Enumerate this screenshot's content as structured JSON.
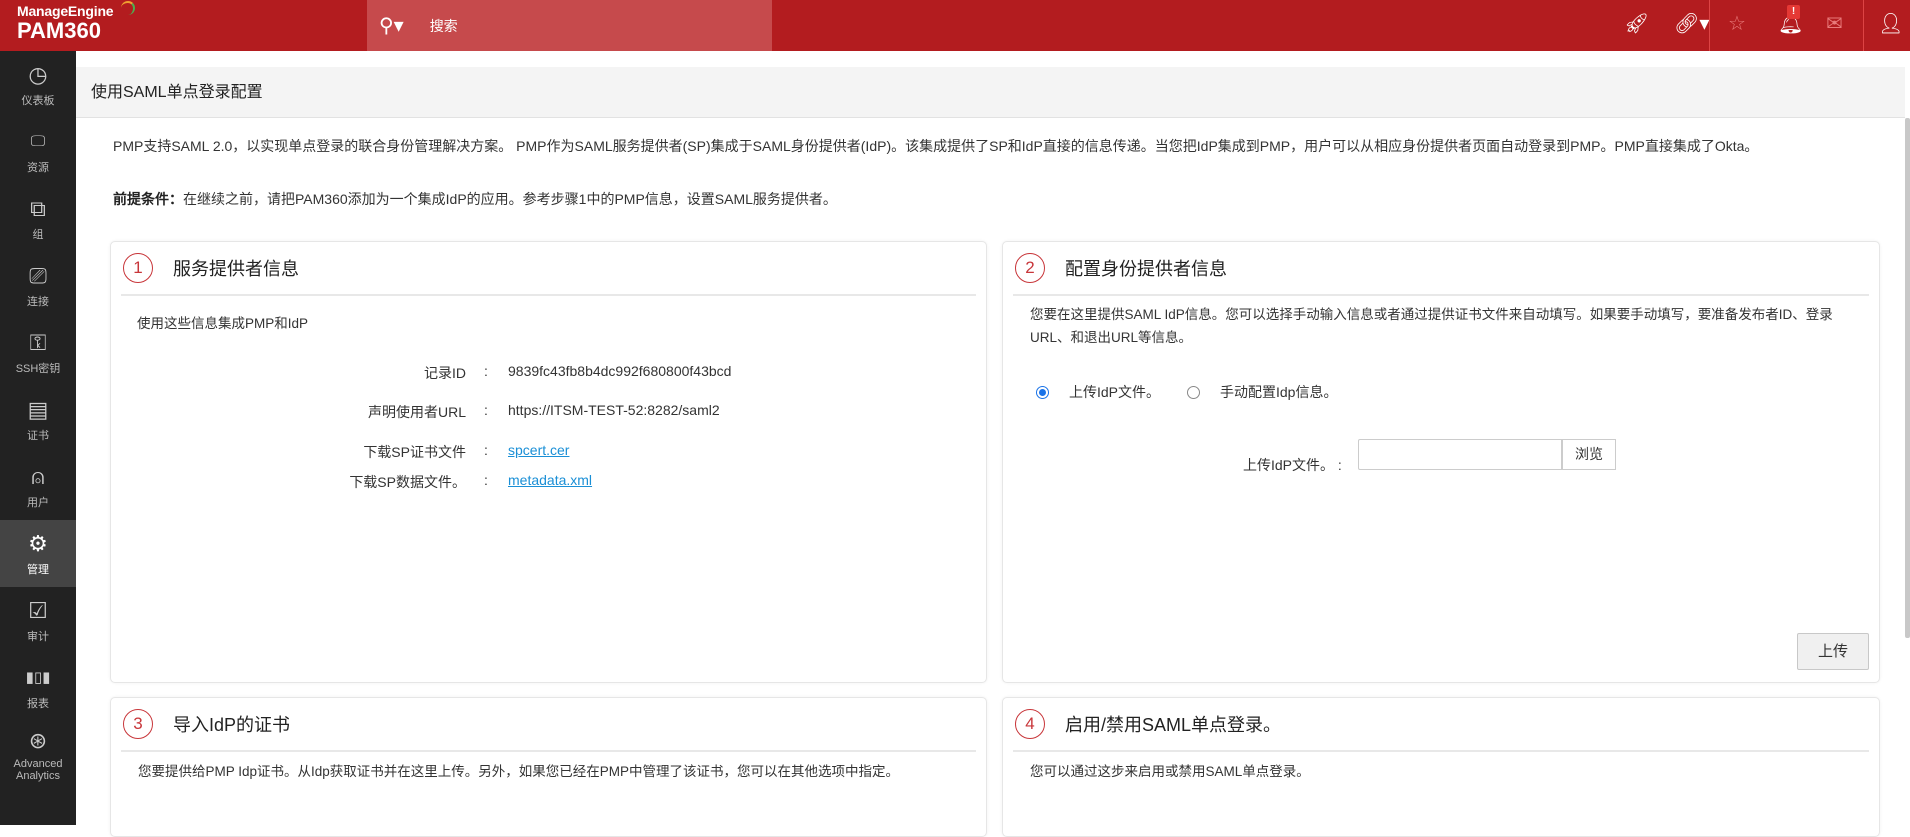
{
  "header": {
    "brand": "ManageEngine",
    "product": "PAM360",
    "search_label": "搜索",
    "notification_badge": "!"
  },
  "sidebar": {
    "items": [
      {
        "label": "仪表板",
        "icon": "dashboard-icon",
        "glyph": "◷"
      },
      {
        "label": "资源",
        "icon": "monitor-icon",
        "glyph": "🖵"
      },
      {
        "label": "组",
        "icon": "group-icon",
        "glyph": "⧉"
      },
      {
        "label": "连接",
        "icon": "connection-icon",
        "glyph": "⎚"
      },
      {
        "label": "SSH密钥",
        "icon": "ssh-key-icon",
        "glyph": "⚿"
      },
      {
        "label": "证书",
        "icon": "certificate-icon",
        "glyph": "▤"
      },
      {
        "label": "用户",
        "icon": "user-icon",
        "glyph": "⍝"
      },
      {
        "label": "管理",
        "icon": "gear-icon",
        "glyph": "⚙",
        "active": true
      },
      {
        "label": "审计",
        "icon": "clipboard-check-icon",
        "glyph": "☑"
      },
      {
        "label": "报表",
        "icon": "bar-chart-icon",
        "glyph": "▮▯▮"
      },
      {
        "label": "Advanced Analytics",
        "icon": "analytics-icon",
        "glyph": "⊛"
      }
    ]
  },
  "page": {
    "title": "使用SAML单点登录配置",
    "intro": "PMP支持SAML 2.0，以实现单点登录的联合身份管理解决方案。 PMP作为SAML服务提供者(SP)集成于SAML身份提供者(IdP)。该集成提供了SP和IdP直接的信息传递。当您把IdP集成到PMP，用户可以从相应身份提供者页面自动登录到PMP。PMP直接集成了Okta。",
    "prereq_label": "前提条件：",
    "prereq_text": "在继续之前，请把PAM360添加为一个集成IdP的应用。参考步骤1中的PMP信息，设置SAML服务提供者。"
  },
  "cards": [
    {
      "num": "1",
      "title": "服务提供者信息",
      "desc": "使用这些信息集成PMP和IdP",
      "fields": [
        {
          "label": "记录ID",
          "sep": ":",
          "value": "9839fc43fb8b4dc992f680800f43bcd"
        },
        {
          "label": "声明使用者URL",
          "sep": ":",
          "value": "https://ITSM-TEST-52:8282/saml2"
        },
        {
          "label": "下载SP证书文件",
          "sep": ":",
          "value": "spcert.cer"
        },
        {
          "label": "下载SP数据文件。",
          "sep": ":",
          "value": "metadata.xml"
        }
      ]
    },
    {
      "num": "2",
      "title": "配置身份提供者信息",
      "desc": "您要在这里提供SAML IdP信息。您可以选择手动输入信息或者通过提供证书文件来自动填写。如果要手动填写，要准备发布者ID、登录URL、和退出URL等信息。",
      "radio_upload": "上传IdP文件。",
      "radio_manual": "手动配置Idp信息。",
      "file_label": "上传IdP文件。 :",
      "file_value": "",
      "browse": "浏览",
      "upload": "上传"
    },
    {
      "num": "3",
      "title": "导入IdP的证书",
      "desc": "您要提供给PMP Idp证书。从Idp获取证书并在这里上传。另外，如果您已经在PMP中管理了该证书，您可以在其他选项中指定。"
    },
    {
      "num": "4",
      "title": "启用/禁用SAML单点登录。",
      "desc": "您可以通过这步来启用或禁用SAML单点登录。"
    }
  ]
}
